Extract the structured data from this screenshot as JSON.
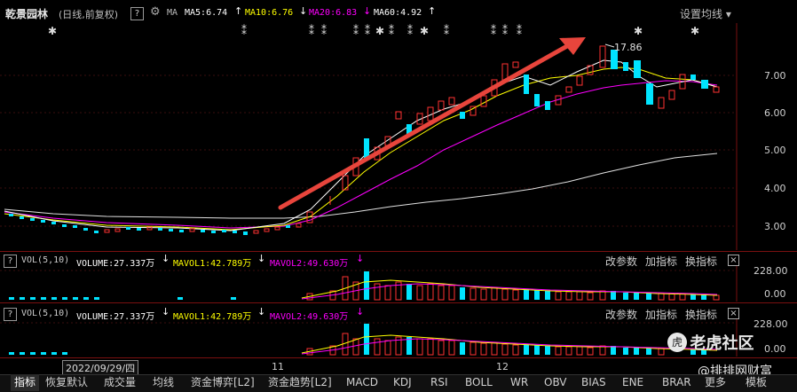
{
  "header": {
    "stock_name": "乾景园林",
    "period_mode": "(日线,前复权)",
    "help_icon": "?",
    "ma_label": "MA",
    "ma5": "MA5:6.74",
    "ma10": "MA10:6.76",
    "ma20": "MA20:6.83",
    "ma60": "MA60:4.92",
    "settings_label": "设置均线",
    "max_label": "17.86"
  },
  "colors": {
    "up": "#ff3232",
    "down": "#00e4ff",
    "ma5": "#ffffff",
    "ma10": "#ffff00",
    "ma20": "#ff00ff",
    "ma60": "#00ff00"
  },
  "price_axis": [
    "7.00",
    "6.00",
    "5.00",
    "4.00",
    "3.00"
  ],
  "vol_panel_1": {
    "label": "VOL(5,10)",
    "volume": "VOLUME:27.337万",
    "mavol1": "MAVOL1:42.789万",
    "mavol2": "MAVOL2:49.630万",
    "btn_change": "改参数",
    "btn_add": "加指标",
    "btn_swap": "换指标",
    "axis": [
      "228.00",
      "0.00"
    ]
  },
  "vol_panel_2": {
    "label": "VOL(5,10)",
    "volume": "VOLUME:27.337万",
    "mavol1": "MAVOL1:42.789万",
    "mavol2": "MAVOL2:49.630万",
    "btn_change": "改参数",
    "btn_add": "加指标",
    "btn_swap": "换指标",
    "axis": [
      "228.00",
      "0.00"
    ]
  },
  "time_axis": {
    "date_box": "2022/09/29/四",
    "month_11": "11",
    "month_12": "12"
  },
  "watermark": {
    "brand": "老虎社区",
    "handle": "@排排网财富"
  },
  "bottom_tabs": [
    "指标",
    "恢复默认",
    "成交量",
    "均线",
    "资金博弈[L2]",
    "资金趋势[L2]",
    "MACD",
    "KDJ",
    "RSI",
    "BOLL",
    "WR",
    "OBV",
    "BIAS",
    "ENE",
    "BRAR",
    "更多"
  ],
  "bottom_right": "模板"
}
